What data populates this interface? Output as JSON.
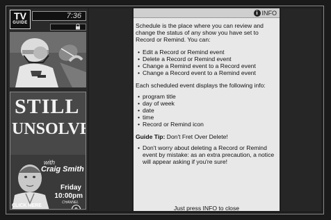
{
  "sidebar": {
    "logo_top": "TV",
    "logo_bottom": "GUIDE",
    "clock": "7:36",
    "status_icon": "lock-icon",
    "ad": {
      "title_line1": "STILL",
      "title_line2": "UNSOLVED",
      "with_text": "with",
      "host": "Craig Smith",
      "day": "Friday",
      "time": "10:00pm",
      "channel_label": "CHANNEL",
      "channel_number": "9",
      "cta": "CLICK HERE"
    }
  },
  "panel": {
    "badge_label": "INFO",
    "intro": "Schedule is the place where you can review and change the status of any show you have set to Record or Remind. You can:",
    "actions": [
      "Edit a Record or Remind event",
      "Delete a Record or Remind event",
      "Change a Remind event to a Record event",
      "Change a Record event to a Remind event"
    ],
    "details_intro": "Each scheduled event displays the following info:",
    "details": [
      "program title",
      "day of week",
      "date",
      "time",
      "Record or Remind icon"
    ],
    "tip_label": "Guide Tip:",
    "tip_title": "Don't Fret Over Delete!",
    "tip_items": [
      "Don't worry about deleting a Record or Remind event by mistake: as an extra precaution, a notice will appear asking if you're sure!"
    ],
    "footer": "Just press INFO to close"
  },
  "colors": {
    "panel_bg": "#e8e8e8",
    "background": "#1a1a1a"
  }
}
